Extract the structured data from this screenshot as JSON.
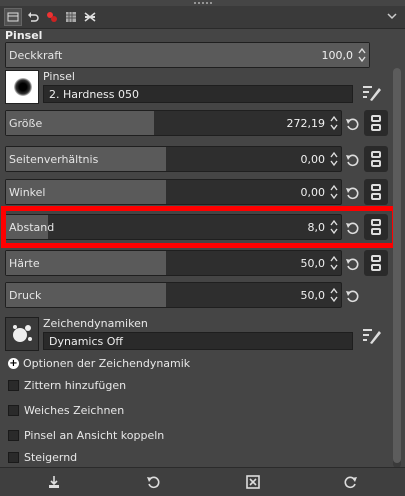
{
  "panel": {
    "title": "Pinsel"
  },
  "opacity": {
    "label": "Deckkraft",
    "value": "100,0",
    "level_percent": 100
  },
  "brush": {
    "label": "Pinsel",
    "name": "2. Hardness 050"
  },
  "sliders": [
    {
      "key": "size",
      "label": "Größe",
      "value": "272,19"
    },
    {
      "key": "aspect",
      "label": "Seitenverhältnis",
      "value": "0,00"
    },
    {
      "key": "angle",
      "label": "Winkel",
      "value": "0,00"
    },
    {
      "key": "spacing",
      "label": "Abstand",
      "value": "8,0"
    },
    {
      "key": "hardness",
      "label": "Härte",
      "value": "50,0"
    },
    {
      "key": "force",
      "label": "Druck",
      "value": "50,0"
    }
  ],
  "dynamics": {
    "label": "Zeichendynamiken",
    "name": "Dynamics Off"
  },
  "options": {
    "dynamics_options": "Optionen der Zeichendynamik",
    "jitter": "Zittern hinzufügen",
    "smooth": "Weiches Zeichnen",
    "lock_view": "Pinsel an Ansicht koppeln",
    "incremental": "Steigernd"
  },
  "icons": {
    "tab1": "tool-options-icon",
    "tab2": "undo-history-icon",
    "tab3": "brush-paint-icon",
    "tab4": "pattern-icon",
    "tab5": "gradient-icon",
    "reset": "reset-icon",
    "chain": "chain-link-icon"
  },
  "colors": {
    "highlight": "#ff0000",
    "background": "#454545"
  }
}
